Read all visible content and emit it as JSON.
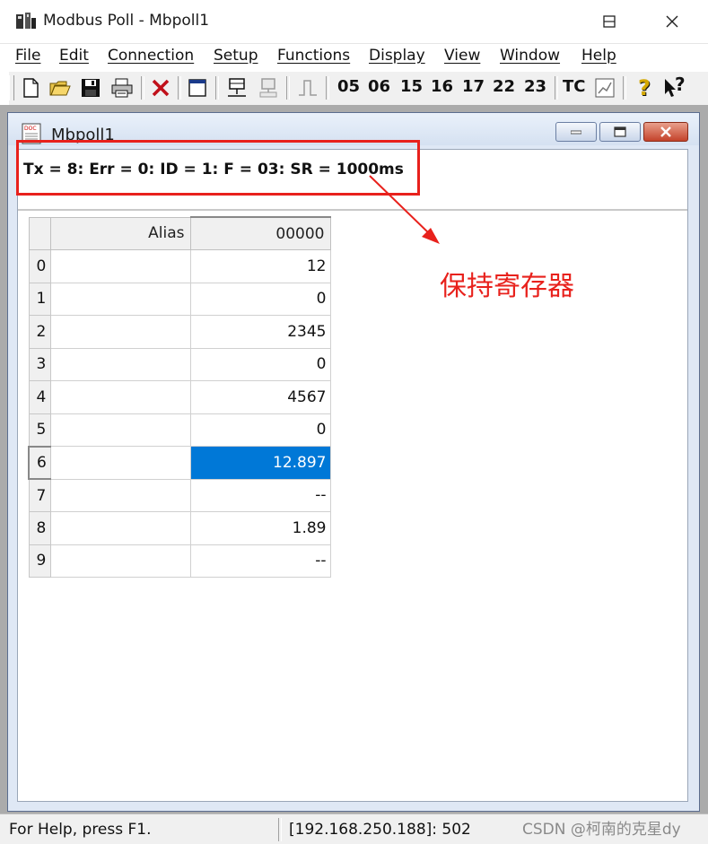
{
  "window": {
    "title": "Modbus Poll - Mbpoll1",
    "minimize_glyph": "─",
    "maximize_glyph": "☐",
    "close_glyph": "✕"
  },
  "menu": {
    "items": [
      {
        "label": "File"
      },
      {
        "label": "Edit"
      },
      {
        "label": "Connection"
      },
      {
        "label": "Setup"
      },
      {
        "label": "Functions"
      },
      {
        "label": "Display"
      },
      {
        "label": "View"
      },
      {
        "label": "Window"
      },
      {
        "label": "Help"
      }
    ]
  },
  "toolbar": {
    "function_codes": [
      "05",
      "06",
      "15",
      "16",
      "17",
      "22",
      "23"
    ],
    "tc_label": "TC",
    "help_glyph": "?",
    "context_help_glyph": "?"
  },
  "child": {
    "title": "Mbpoll1",
    "status_line": "Tx = 8: Err = 0: ID = 1: F = 03: SR = 1000ms"
  },
  "grid": {
    "alias_header": "Alias",
    "value_header": "00000",
    "rows": [
      {
        "index": "0",
        "value": "12"
      },
      {
        "index": "1",
        "value": "0"
      },
      {
        "index": "2",
        "value": "2345"
      },
      {
        "index": "3",
        "value": "0"
      },
      {
        "index": "4",
        "value": "4567"
      },
      {
        "index": "5",
        "value": "0"
      },
      {
        "index": "6",
        "value": "12.897"
      },
      {
        "index": "7",
        "value": "--"
      },
      {
        "index": "8",
        "value": "1.89"
      },
      {
        "index": "9",
        "value": "--"
      }
    ],
    "selected_row": 6
  },
  "annotation": {
    "label": "保持寄存器",
    "color": "#e8211c"
  },
  "statusbar": {
    "help_text": "For Help, press F1.",
    "connection": "[192.168.250.188]: 502"
  },
  "watermark": "CSDN @柯南的克星dy",
  "colors": {
    "selection": "#0078d7",
    "annotation": "#e8211c"
  }
}
